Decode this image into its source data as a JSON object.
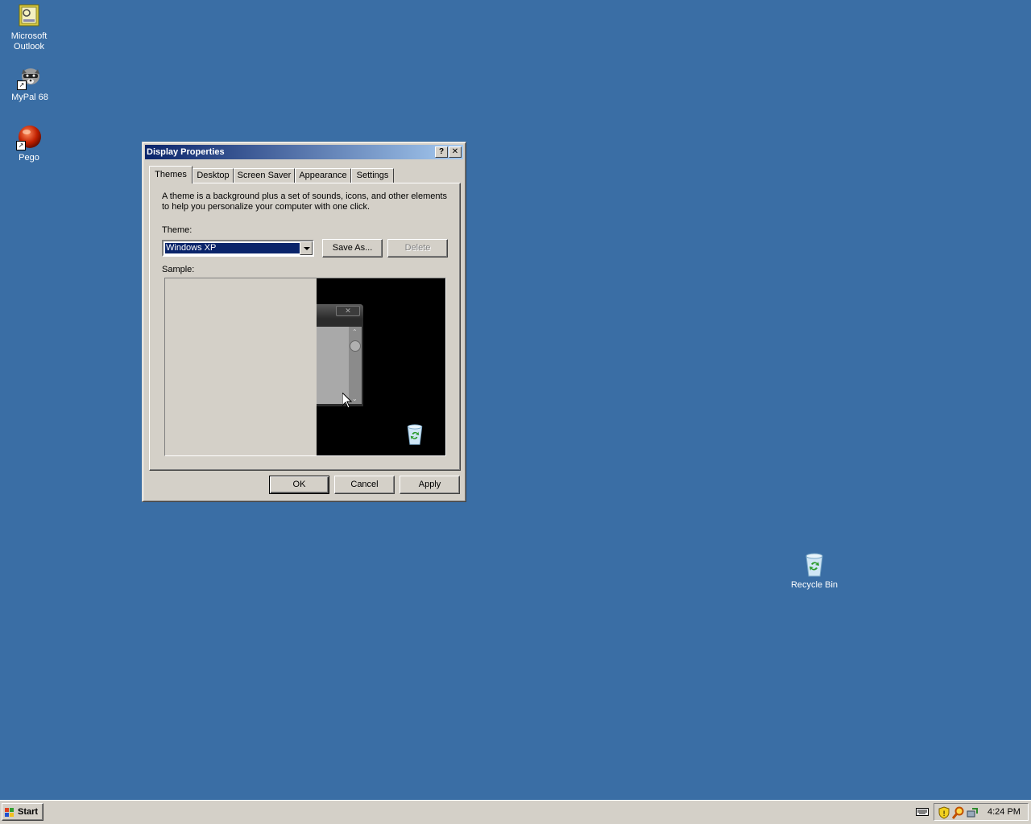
{
  "desktop": {
    "icons": [
      {
        "label_line1": "Microsoft",
        "label_line2": "Outlook"
      },
      {
        "label": "MyPal 68"
      },
      {
        "label": "Pego"
      },
      {
        "label": "Recycle Bin"
      }
    ]
  },
  "dialog": {
    "title": "Display Properties",
    "help_glyph": "?",
    "close_glyph": "✕",
    "tabs": [
      {
        "label": "Themes",
        "active": true
      },
      {
        "label": "Desktop"
      },
      {
        "label": "Screen Saver"
      },
      {
        "label": "Appearance"
      },
      {
        "label": "Settings"
      }
    ],
    "description": "A theme is a background plus a set of sounds, icons, and other elements to help you personalize your computer with one click.",
    "theme_label": "Theme:",
    "theme_value": "Windows XP",
    "save_as_label": "Save As...",
    "delete_label": "Delete",
    "sample_label": "Sample:",
    "ok_label": "OK",
    "cancel_label": "Cancel",
    "apply_label": "Apply"
  },
  "taskbar": {
    "start_label": "Start",
    "clock": "4:24 PM"
  },
  "colors": {
    "desktop": "#3a6ea5",
    "face": "#d4d0c8",
    "title_start": "#0a246a",
    "title_end": "#a6caf0"
  }
}
